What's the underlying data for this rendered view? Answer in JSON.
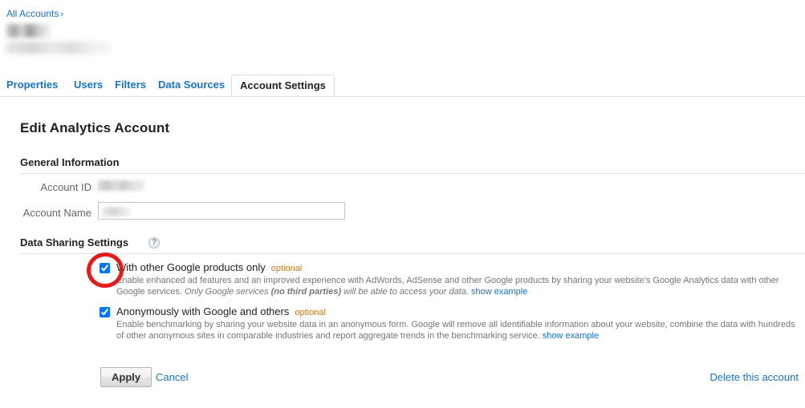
{
  "breadcrumb": {
    "all_accounts_label": "All Accounts",
    "separator": "›",
    "account_name_redacted": "",
    "account_property_redacted": ""
  },
  "tabs": [
    {
      "label": "Properties",
      "active": false
    },
    {
      "label": "Users",
      "active": false
    },
    {
      "label": "Filters",
      "active": false
    },
    {
      "label": "Data Sources",
      "active": false
    },
    {
      "label": "Account Settings",
      "active": true
    }
  ],
  "page": {
    "title": "Edit Analytics Account"
  },
  "general_information": {
    "heading": "General Information",
    "account_id_label": "Account ID",
    "account_id_value": "",
    "account_name_label": "Account Name",
    "account_name_value": "",
    "account_name_placeholder": ""
  },
  "data_sharing": {
    "heading": "Data Sharing Settings",
    "help_icon_label": "?",
    "options": [
      {
        "title": "With other Google products only",
        "optional_label": "optional",
        "checked": true,
        "desc_part1": "Enable enhanced ad features and an improved experience with AdWords, AdSense and other Google products by sharing your website's Google Analytics data with other Google services. ",
        "desc_italic": "Only Google services ",
        "desc_italic_bold": "(no third parties)",
        "desc_italic2": " will be able to access your data. ",
        "show_example_label": "show example"
      },
      {
        "title": "Anonymously with Google and others",
        "optional_label": "optional",
        "checked": true,
        "desc_part1": "Enable benchmarking by sharing your website data in an anonymous form. Google will remove all identifiable information about your website, combine the data with hundreds of other anonymous sites in comparable industries and report aggregate trends in the benchmarking service. ",
        "desc_italic": "",
        "desc_italic_bold": "",
        "desc_italic2": "",
        "show_example_label": "show example"
      }
    ]
  },
  "footer": {
    "apply_label": "Apply",
    "cancel_label": "Cancel",
    "delete_account_label": "Delete this account"
  },
  "annotation": {
    "type": "red-circle-highlight",
    "target": "with-other-google-products-only-checkbox",
    "color": "#e51a1a"
  }
}
